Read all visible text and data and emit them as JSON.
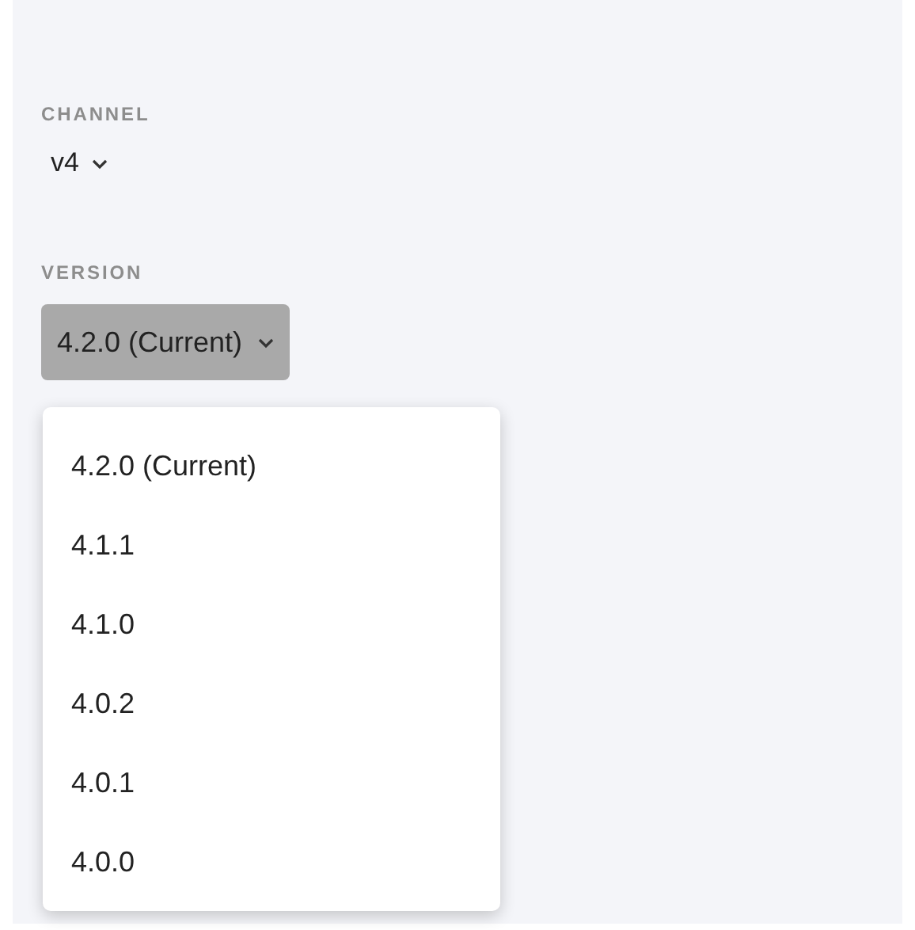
{
  "channel": {
    "label": "CHANNEL",
    "value": "v4"
  },
  "version": {
    "label": "VERSION",
    "value": "4.2.0 (Current)",
    "expanded": true,
    "options": [
      "4.2.0 (Current)",
      "4.1.1",
      "4.1.0",
      "4.0.2",
      "4.0.1",
      "4.0.0"
    ]
  }
}
